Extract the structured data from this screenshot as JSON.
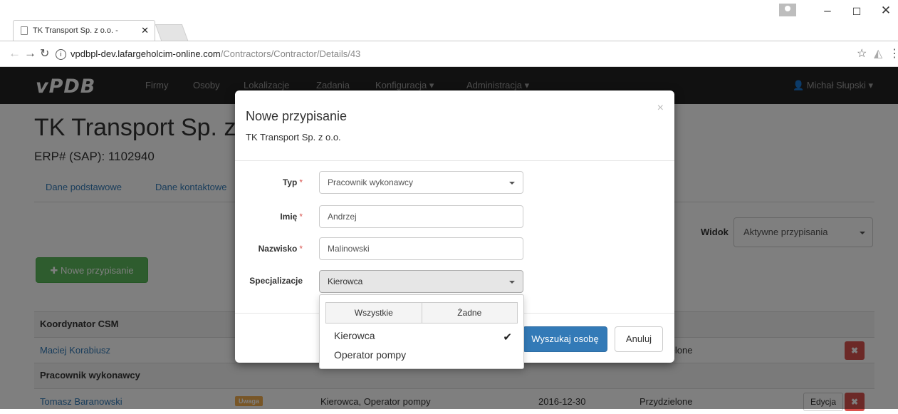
{
  "browser": {
    "tab_title": "TK Transport Sp. z o.o. - ",
    "url_domain": "vpdbpl-dev.lafargeholcim-online.com",
    "url_path": "/Contractors/Contractor/Details/43"
  },
  "navbar": {
    "brand": "vPDB",
    "items": [
      "Firmy",
      "Osoby",
      "Lokalizacje",
      "Zadania",
      "Konfiguracja ▾",
      "Administracja ▾"
    ],
    "user": "Michał Słupski ▾"
  },
  "page": {
    "title": "TK Transport Sp. z o.o.",
    "erp": "ERP# (SAP): 1102940",
    "tabs": [
      "Dane podstawowe",
      "Dane kontaktowe"
    ],
    "new_button": "Nowe przypisanie",
    "view_label": "Widok",
    "view_value": "Aktywne przypisania"
  },
  "table": {
    "section1": "Koordynator CSM",
    "row1": {
      "name": "Maciej Korabiusz",
      "status": "Przydzielone"
    },
    "section2": "Pracownik wykonawcy",
    "row2": {
      "name": "Tomasz Baranowski",
      "badge": "Uwaga",
      "spec": "Kierowca, Operator pompy",
      "date": "2016-12-30",
      "status": "Przydzielone",
      "edit": "Edycja"
    }
  },
  "modal": {
    "title": "Nowe przypisanie",
    "subtitle": "TK Transport Sp. z o.o.",
    "close": "×",
    "fields": {
      "type_label": "Typ",
      "type_value": "Pracownik wykonawcy",
      "first_label": "Imię",
      "first_value": "Andrzej",
      "last_label": "Nazwisko",
      "last_value": "Malinowski",
      "spec_label": "Specjalizacje",
      "spec_value": "Kierowca"
    },
    "search_button": "Wyszukaj osobę",
    "cancel_button": "Anuluj"
  },
  "dropdown": {
    "select_all": "Wszystkie",
    "select_none": "Żadne",
    "options": [
      "Kierowca",
      "Operator pompy"
    ],
    "checked": "✔"
  }
}
